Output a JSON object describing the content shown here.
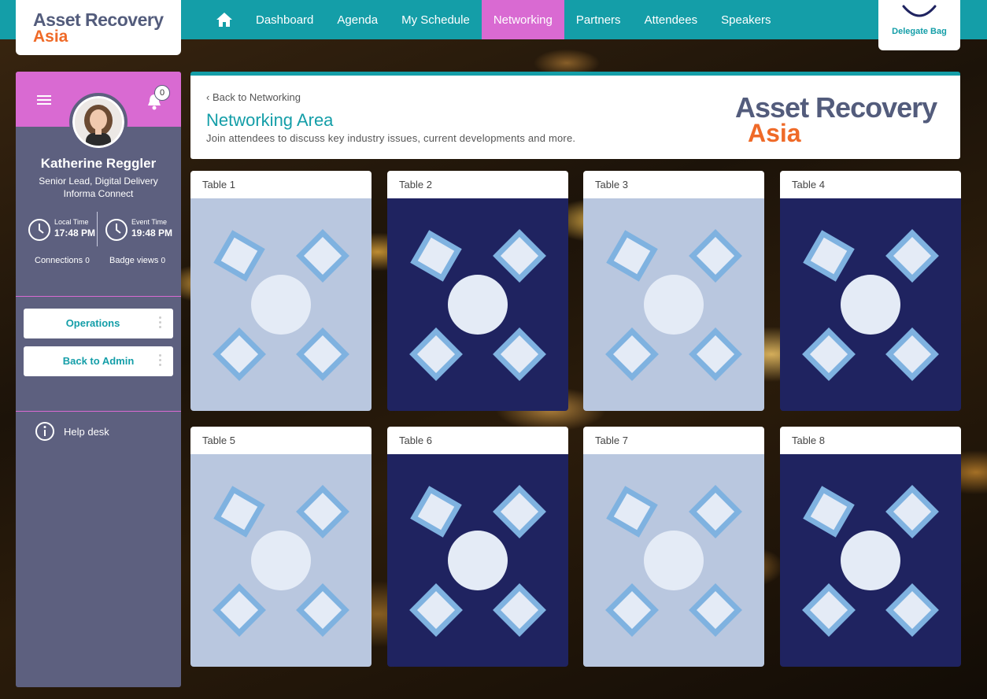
{
  "brand": {
    "logo_line1": "Asset Recovery",
    "logo_line2": "Asia",
    "primary_color": "#149ea8",
    "accent_color": "#d96ad2",
    "logo_orange": "#ef6a28"
  },
  "nav": {
    "home_icon": "home-icon",
    "items": [
      {
        "label": "Dashboard",
        "active": false
      },
      {
        "label": "Agenda",
        "active": false
      },
      {
        "label": "My Schedule",
        "active": false
      },
      {
        "label": "Networking",
        "active": true
      },
      {
        "label": "Partners",
        "active": false
      },
      {
        "label": "Attendees",
        "active": false
      },
      {
        "label": "Speakers",
        "active": false
      }
    ],
    "delegate_bag_label": "Delegate Bag"
  },
  "sidebar": {
    "notification_count": "0",
    "user_name": "Katherine Reggler",
    "user_role": "Senior Lead, Digital Delivery",
    "user_org": "Informa Connect",
    "local_time_label": "Local Time",
    "local_time": "17:48 PM",
    "event_time_label": "Event Time",
    "event_time": "19:48 PM",
    "connections_label": "Connections",
    "connections_count": "0",
    "badge_views_label": "Badge views",
    "badge_views_count": "0",
    "buttons": [
      {
        "label": "Operations"
      },
      {
        "label": "Back to Admin"
      }
    ],
    "help_label": "Help desk"
  },
  "header": {
    "back_label": "‹ Back to Networking",
    "title": "Networking Area",
    "subtitle": "Join attendees to discuss key industry issues, current developments and more.",
    "logo_line1": "Asset Recovery",
    "logo_line2": "Asia"
  },
  "tables": [
    {
      "label": "Table 1",
      "theme": "light"
    },
    {
      "label": "Table 2",
      "theme": "dark"
    },
    {
      "label": "Table 3",
      "theme": "light"
    },
    {
      "label": "Table 4",
      "theme": "dark"
    },
    {
      "label": "Table 5",
      "theme": "light"
    },
    {
      "label": "Table 6",
      "theme": "dark"
    },
    {
      "label": "Table 7",
      "theme": "light"
    },
    {
      "label": "Table 8",
      "theme": "dark"
    }
  ]
}
